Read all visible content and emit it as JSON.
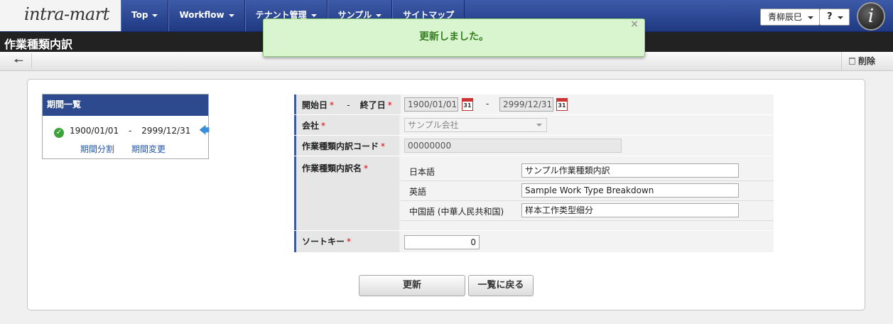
{
  "header": {
    "logo_text": "intra-mart",
    "nav": [
      {
        "label": "Top"
      },
      {
        "label": "Workflow"
      },
      {
        "label": "テナント管理"
      },
      {
        "label": "サンプル"
      },
      {
        "label": "サイトマップ"
      }
    ],
    "user_name": "青柳辰巳",
    "help_label": "?",
    "im_letter": "i"
  },
  "title": "作業種類内訳",
  "toolbar": {
    "back_icon": "arrow-left-icon",
    "delete_label": "削除"
  },
  "toast": {
    "message": "更新しました。",
    "close": "×"
  },
  "period_list": {
    "title": "期間一覧",
    "start": "1900/01/01",
    "separator": "-",
    "end": "2999/12/31",
    "link_split": "期間分割",
    "link_change": "期間変更"
  },
  "form": {
    "start_label": "開始日",
    "dash": "-",
    "end_label": "終了日",
    "start_value": "1900/01/01",
    "end_value": "2999/12/31",
    "cal_text": "31",
    "company_label": "会社",
    "company_value": "サンプル会社",
    "code_label": "作業種類内訳コード",
    "code_value": "00000000",
    "name_label": "作業種類内訳名",
    "names": [
      {
        "lang": "日本語",
        "value": "サンプル作業種類内訳"
      },
      {
        "lang": "英語",
        "value": "Sample Work Type Breakdown"
      },
      {
        "lang": "中国語 (中華人民共和国)",
        "value": "样本工作类型细分"
      }
    ],
    "sort_label": "ソートキー",
    "sort_value": "0",
    "required_mark": "*"
  },
  "buttons": {
    "update": "更新",
    "back_to_list": "一覧に戻る"
  }
}
